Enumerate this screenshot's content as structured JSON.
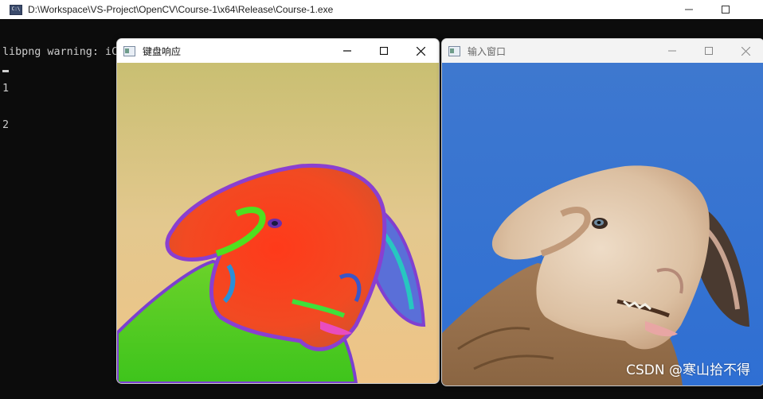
{
  "console": {
    "title": "D:\\Workspace\\VS-Project\\OpenCV\\Course-1\\x64\\Release\\Course-1.exe",
    "lines": [
      "libpng warning: iCCP: cHRM chunk does not match sRGB",
      "1",
      "2"
    ]
  },
  "windows": {
    "keyboard": {
      "title": "键盘响应",
      "active": true
    },
    "input": {
      "title": "输入窗口",
      "active": false
    }
  },
  "icons": {
    "minimize": "minimize-icon",
    "maximize": "maximize-icon",
    "close": "close-icon"
  },
  "watermark": "CSDN @寒山拾不得"
}
